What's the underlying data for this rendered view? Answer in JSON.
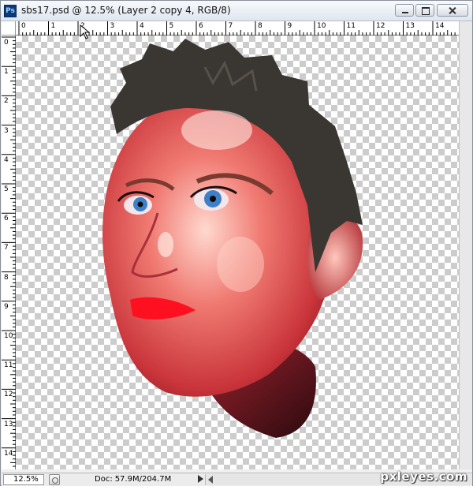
{
  "window": {
    "app_icon": "Ps",
    "title": "sbs17.psd @ 12.5% (Layer 2 copy 4, RGB/8)"
  },
  "rulers": {
    "horizontal_labels": [
      "0",
      "1",
      "2",
      "3",
      "4",
      "5",
      "6",
      "7",
      "8",
      "9",
      "10",
      "11",
      "12",
      "13",
      "14"
    ],
    "vertical_labels": [
      "0",
      "1",
      "2",
      "3",
      "4",
      "5",
      "6",
      "7",
      "8",
      "9",
      "10",
      "11",
      "12",
      "13",
      "14"
    ]
  },
  "status": {
    "zoom": "12.5%",
    "doc_label": "Doc:",
    "doc_size": "57.9M/204.7M"
  },
  "watermark": "pxleyes.com",
  "colors": {
    "checker_light": "#ffffff",
    "checker_dark": "#cccccc",
    "skin": "#e85a58",
    "hair": "#3a3631",
    "lips": "#ff1020",
    "eyes": "#3f7fc8"
  },
  "icons": [
    "photoshop-app-icon",
    "minimize-icon",
    "maximize-icon",
    "close-icon",
    "arrow-cursor-icon"
  ]
}
